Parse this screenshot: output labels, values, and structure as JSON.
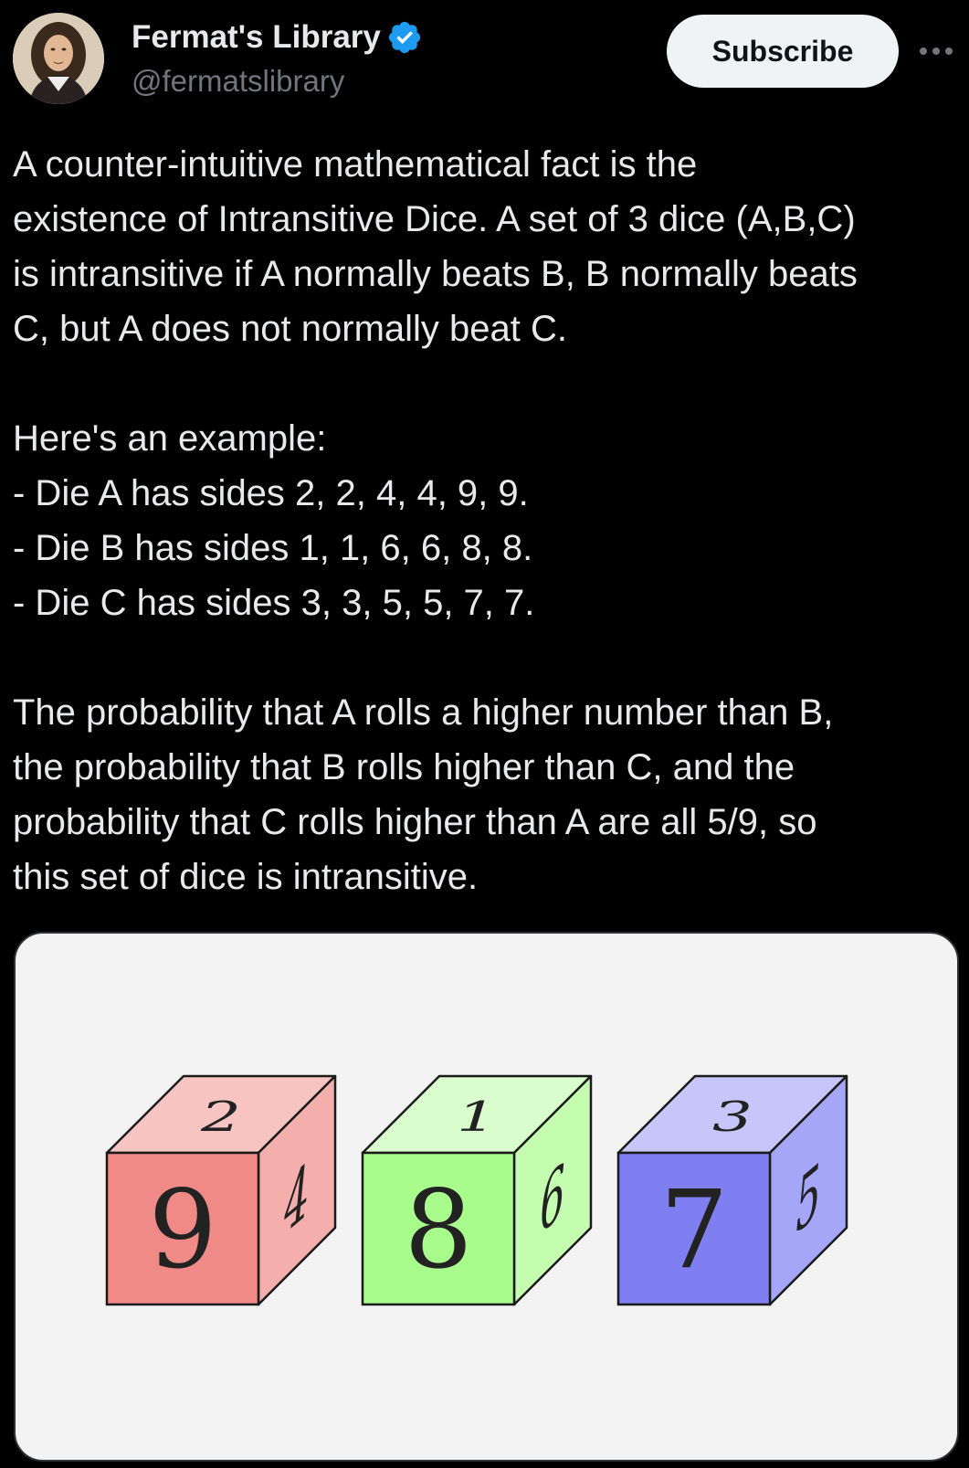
{
  "author": {
    "display_name": "Fermat's Library",
    "handle": "@fermatslibrary",
    "verified_color": "#1d9bf0"
  },
  "actions": {
    "subscribe_label": "Subscribe",
    "more_icon": "more-horizontal-icon"
  },
  "tweet": {
    "paragraph1": [
      "A counter-intuitive mathematical fact is the",
      "existence of Intransitive Dice. A set of 3 dice (A,B,C)",
      "is intransitive if A normally beats B, B normally beats",
      "C, but A does not normally beat C."
    ],
    "paragraph2": [
      "Here's an example:",
      "- Die A has sides 2, 2, 4, 4, 9, 9.",
      "- Die B has sides 1, 1, 6, 6, 8, 8.",
      "- Die C has sides 3, 3, 5, 5, 7, 7."
    ],
    "paragraph3": [
      "The probability that A rolls a higher number than B,",
      "the probability that B rolls higher than C, and the",
      "probability that C rolls higher than A are all 5/9, so",
      "this set of dice is intransitive."
    ]
  },
  "media": {
    "background": "#f3f3f3",
    "dice": [
      {
        "front": "9",
        "top": "2",
        "side": "4",
        "front_color": "#f08a86",
        "top_color": "#f8c4c1",
        "side_color": "#f4aeab"
      },
      {
        "front": "8",
        "top": "1",
        "side": "6",
        "front_color": "#a8fc8c",
        "top_color": "#d9fdcc",
        "side_color": "#c4fdb0"
      },
      {
        "front": "7",
        "top": "3",
        "side": "5",
        "front_color": "#7f7ff2",
        "top_color": "#c6c6fb",
        "side_color": "#a6a6f8"
      }
    ]
  }
}
